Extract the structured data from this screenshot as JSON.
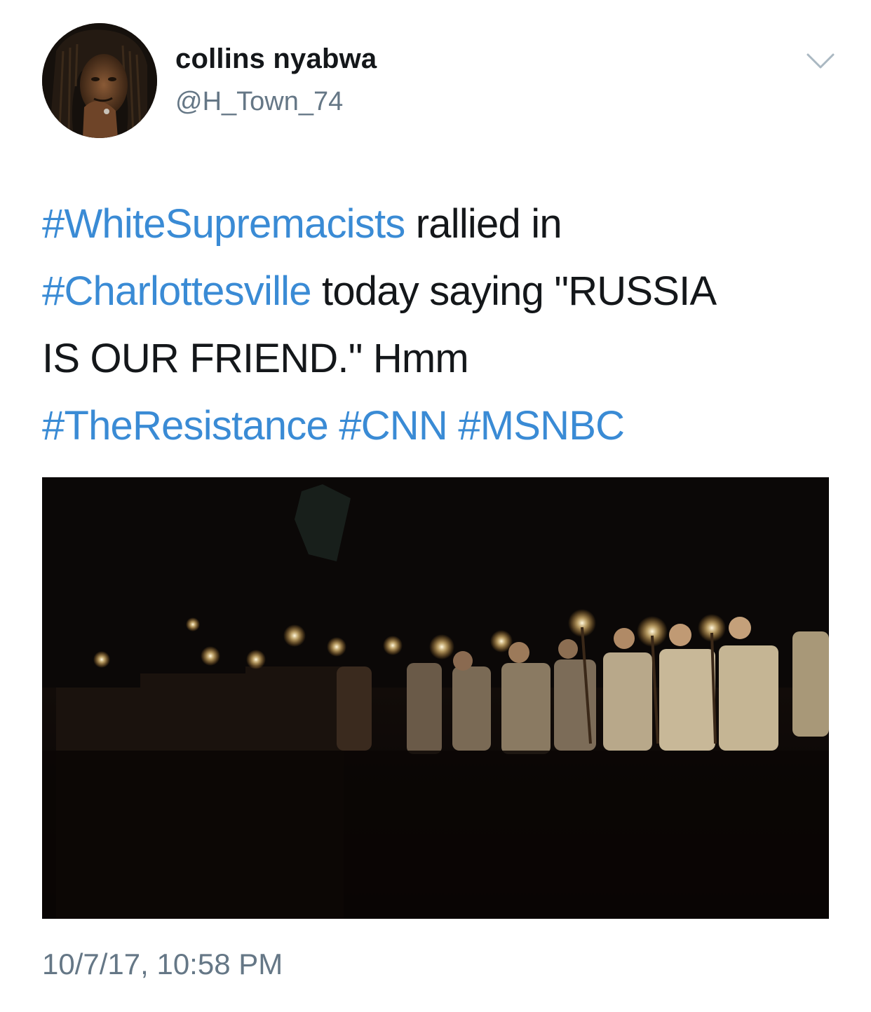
{
  "author": {
    "display_name": "collins nyabwa",
    "handle": "@H_Town_74"
  },
  "tweet": {
    "line1": {
      "hashtag": "#WhiteSupremacists",
      "text": " rallied in"
    },
    "line2": {
      "hashtag": "#Charlottesville",
      "text": " today saying \"RUSSIA"
    },
    "line3": {
      "text": "IS OUR FRIEND.\" Hmm"
    },
    "line4": {
      "tags": [
        "#TheResistance",
        "#CNN",
        "#MSNBC"
      ]
    }
  },
  "timestamp": "10/7/17, 10:58 PM",
  "icons": {
    "menu": "chevron-down-icon"
  },
  "colors": {
    "hashtag": "#3a8bd5",
    "secondary_text": "#657786",
    "primary_text": "#14171a"
  }
}
